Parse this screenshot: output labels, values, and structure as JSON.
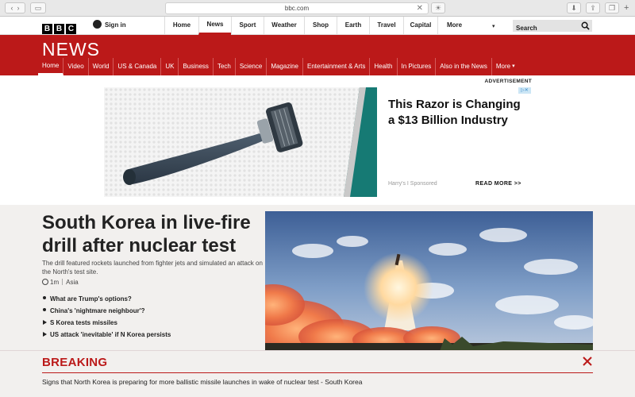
{
  "browser": {
    "url": "bbc.com",
    "add_tab_label": "+"
  },
  "topbar": {
    "logo_letters": [
      "B",
      "B",
      "C"
    ],
    "signin_label": "Sign in",
    "nav": [
      {
        "label": "Home",
        "width": 43
      },
      {
        "label": "News",
        "width": 41,
        "active": true
      },
      {
        "label": "Sport",
        "width": 41
      },
      {
        "label": "Weather",
        "width": 51
      },
      {
        "label": "Shop",
        "width": 41
      },
      {
        "label": "Earth",
        "width": 41
      },
      {
        "label": "Travel",
        "width": 43
      },
      {
        "label": "Capital",
        "width": 43
      },
      {
        "label": "More",
        "width": 74
      }
    ],
    "search_label": "Search"
  },
  "newsbar": {
    "title": "NEWS",
    "nav": [
      "Home",
      "Video",
      "World",
      "US & Canada",
      "UK",
      "Business",
      "Tech",
      "Science",
      "Magazine",
      "Entertainment & Arts",
      "Health",
      "In Pictures",
      "Also in the News",
      "More"
    ],
    "more_arrow": "▾"
  },
  "advert": {
    "label": "ADVERTISEMENT",
    "headline": "This Razor is Changing a $13 Billion Industry",
    "sponsor": "Harry's I Sponsored",
    "read_more": "READ MORE >>"
  },
  "story": {
    "headline": "South Korea in live-fire drill after nuclear test",
    "summary": "The drill featured rockets launched from fighter jets and simulated an attack on the North's test site.",
    "time_ago": "1m",
    "section": "Asia",
    "related": [
      {
        "label": "What are Trump's options?",
        "kind": "article"
      },
      {
        "label": "China's 'nightmare neighbour'?",
        "kind": "article"
      },
      {
        "label": "S Korea tests missiles",
        "kind": "video"
      },
      {
        "label": "US attack 'inevitable' if N Korea persists",
        "kind": "video"
      }
    ]
  },
  "breaking": {
    "title": "BREAKING",
    "text": "Signs that North Korea is preparing for more ballistic missile launches in wake of nuclear test - South Korea"
  },
  "colors": {
    "brand_red": "#bb1919"
  }
}
